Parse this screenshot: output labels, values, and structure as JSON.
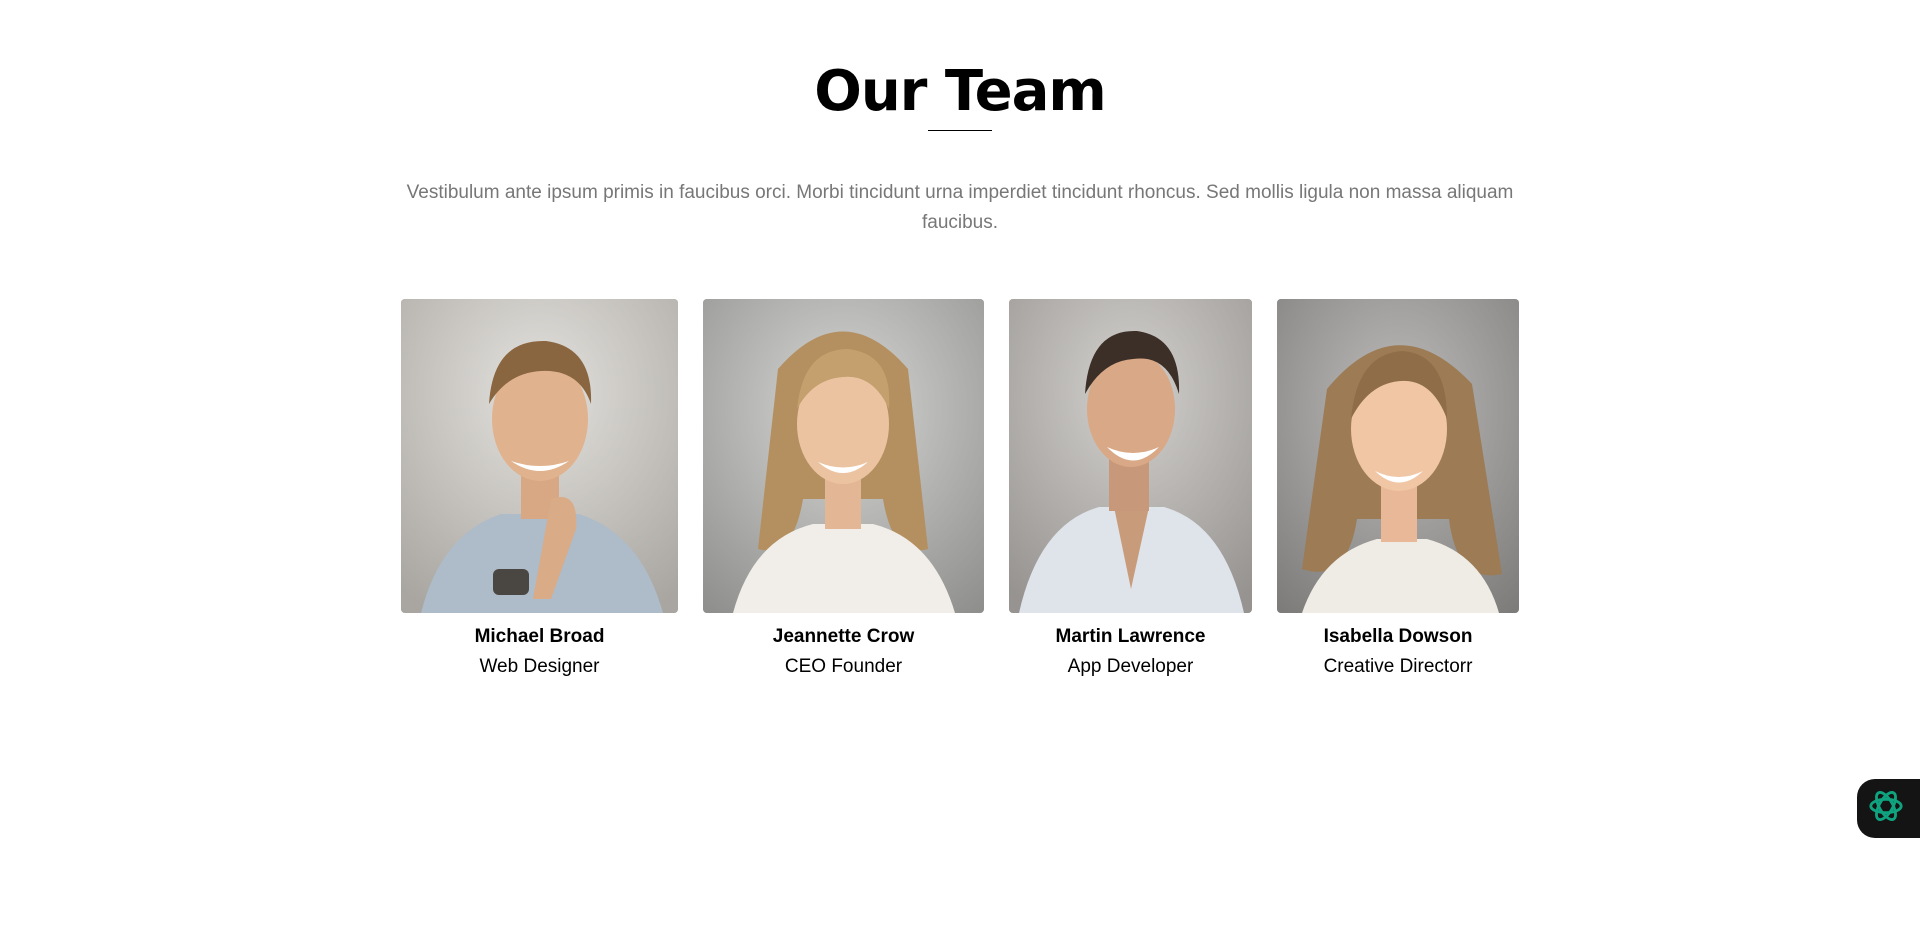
{
  "section": {
    "title": "Our Team",
    "intro": "Vestibulum ante ipsum primis in faucibus orci. Morbi tincidunt urna imperdiet tincidunt rhoncus. Sed mollis ligula non massa aliquam faucibus."
  },
  "team": [
    {
      "name": "Michael Broad",
      "role": "Web Designer",
      "photo": "portrait-man-short-hair"
    },
    {
      "name": "Jeannette Crow",
      "role": "CEO Founder",
      "photo": "portrait-woman-long-hair"
    },
    {
      "name": "Martin Lawrence",
      "role": "App Developer",
      "photo": "portrait-man-smiling"
    },
    {
      "name": "Isabella Dowson",
      "role": "Creative Directorr",
      "photo": "portrait-woman-wavy-hair"
    }
  ],
  "assistant": {
    "icon": "openai-knot-icon",
    "accent": "#10a37f"
  },
  "colors": {
    "title": "#000000",
    "intro_text": "#777777",
    "fab_bg": "#141414"
  }
}
